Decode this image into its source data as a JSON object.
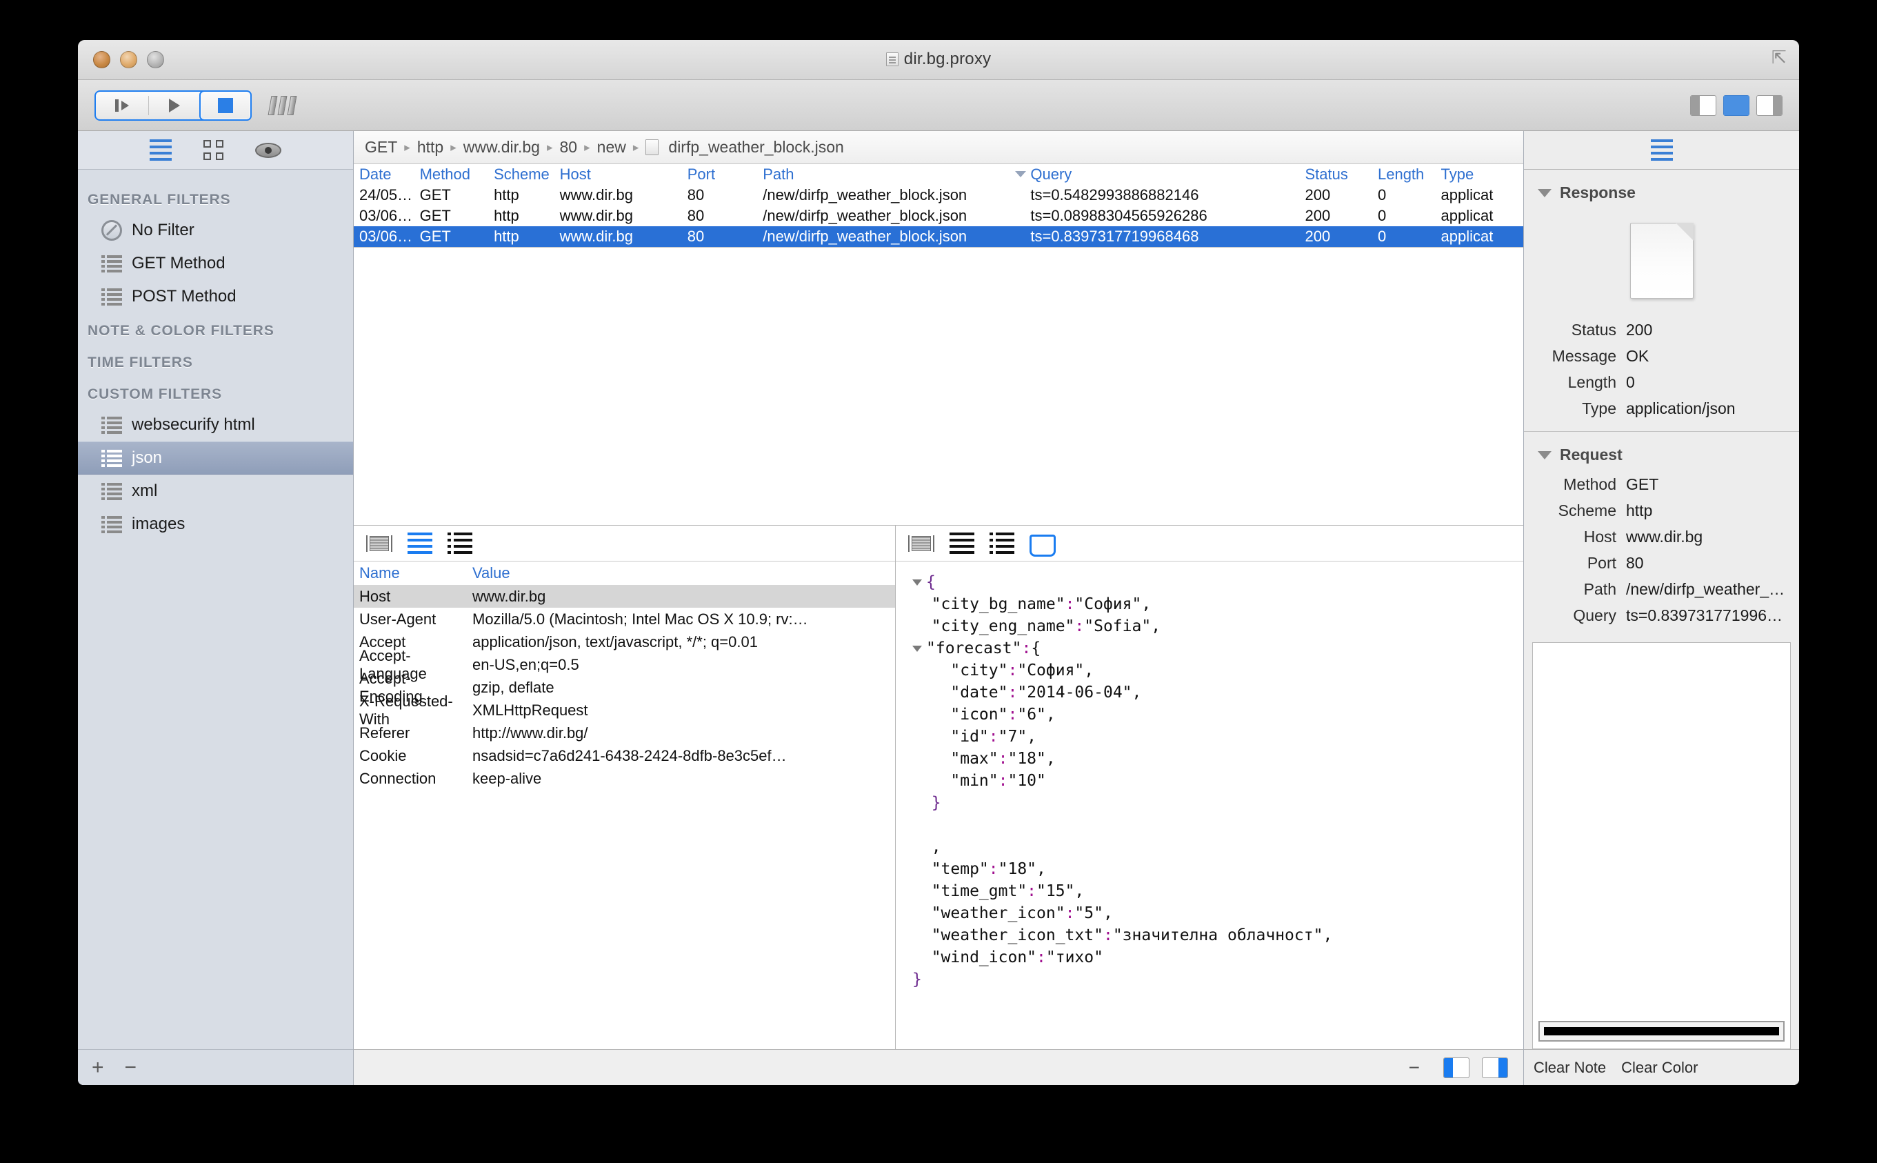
{
  "window": {
    "title": "dir.bg.proxy",
    "traffic_lights": [
      "close",
      "minimize",
      "zoom"
    ]
  },
  "toolbar": {
    "buttons": [
      {
        "name": "step",
        "icon": "step-forward-icon"
      },
      {
        "name": "play",
        "icon": "play-icon"
      },
      {
        "name": "stop",
        "icon": "stop-icon",
        "active": true
      }
    ],
    "columns_icon": "columns-icon",
    "pane_toggles": [
      {
        "name": "left-pane-toggle",
        "icon": "left-pane-icon"
      },
      {
        "name": "bottom-pane-toggle",
        "icon": "bottom-pane-icon"
      },
      {
        "name": "right-pane-toggle",
        "icon": "right-pane-icon"
      }
    ]
  },
  "sidebar": {
    "view_icons": [
      {
        "name": "list-view-icon",
        "active": true
      },
      {
        "name": "grid-view-icon",
        "active": false
      },
      {
        "name": "eye-icon",
        "active": false
      }
    ],
    "groups": [
      {
        "title": "GENERAL FILTERS",
        "items": [
          {
            "label": "No Filter",
            "icon": "no-filter-icon",
            "selected": false
          },
          {
            "label": "GET Method",
            "icon": "list-icon",
            "selected": false
          },
          {
            "label": "POST Method",
            "icon": "list-icon",
            "selected": false
          }
        ]
      },
      {
        "title": "NOTE & COLOR FILTERS",
        "items": []
      },
      {
        "title": "TIME FILTERS",
        "items": []
      },
      {
        "title": "CUSTOM FILTERS",
        "items": [
          {
            "label": "websecurify html",
            "icon": "list-icon",
            "selected": false
          },
          {
            "label": "json",
            "icon": "list-icon",
            "selected": true
          },
          {
            "label": "xml",
            "icon": "list-icon",
            "selected": false
          },
          {
            "label": "images",
            "icon": "list-icon",
            "selected": false
          }
        ]
      }
    ],
    "footer": {
      "add": "+",
      "remove": "−"
    }
  },
  "breadcrumb": {
    "separator": "▸",
    "parts": [
      "GET",
      "http",
      "www.dir.bg",
      "80",
      "new"
    ],
    "file": "dirfp_weather_block.json"
  },
  "requests_table": {
    "columns": [
      "Date",
      "Method",
      "Scheme",
      "Host",
      "Port",
      "Path",
      "Query",
      "Status",
      "Length",
      "Type"
    ],
    "sorted_column": "Query",
    "rows": [
      {
        "date": "24/05…",
        "method": "GET",
        "scheme": "http",
        "host": "www.dir.bg",
        "port": "80",
        "path": "/new/dirfp_weather_block.json",
        "query": "ts=0.5482993886882146",
        "status": "200",
        "length": "0",
        "type": "applicat",
        "selected": false
      },
      {
        "date": "03/06…",
        "method": "GET",
        "scheme": "http",
        "host": "www.dir.bg",
        "port": "80",
        "path": "/new/dirfp_weather_block.json",
        "query": "ts=0.08988304565926286",
        "status": "200",
        "length": "0",
        "type": "applicat",
        "selected": false
      },
      {
        "date": "03/06…",
        "method": "GET",
        "scheme": "http",
        "host": "www.dir.bg",
        "port": "80",
        "path": "/new/dirfp_weather_block.json",
        "query": "ts=0.8397317719968468",
        "status": "200",
        "length": "0",
        "type": "applicat",
        "selected": true
      }
    ]
  },
  "headers_panel": {
    "toolbar_icons": [
      {
        "name": "raw-view-icon",
        "active": false
      },
      {
        "name": "lines-view-icon",
        "active": true
      },
      {
        "name": "bullet-list-view-icon",
        "active": false
      }
    ],
    "columns": [
      "Name",
      "Value"
    ],
    "rows": [
      {
        "name": "Host",
        "value": "www.dir.bg",
        "selected": true
      },
      {
        "name": "User-Agent",
        "value": "Mozilla/5.0 (Macintosh; Intel Mac OS X 10.9; rv:…",
        "selected": false
      },
      {
        "name": "Accept",
        "value": "application/json, text/javascript, */*; q=0.01",
        "selected": false
      },
      {
        "name": "Accept-Language",
        "value": "en-US,en;q=0.5",
        "selected": false
      },
      {
        "name": "Accept-Encoding",
        "value": "gzip, deflate",
        "selected": false
      },
      {
        "name": "X-Requested-With",
        "value": "XMLHttpRequest",
        "selected": false
      },
      {
        "name": "Referer",
        "value": "http://www.dir.bg/",
        "selected": false
      },
      {
        "name": "Cookie",
        "value": "nsadsid=c7a6d241-6438-2424-8dfb-8e3c5ef…",
        "selected": false
      },
      {
        "name": "Connection",
        "value": "keep-alive",
        "selected": false
      }
    ]
  },
  "body_panel": {
    "toolbar_icons": [
      {
        "name": "raw-view-icon",
        "active": false
      },
      {
        "name": "lines-view-icon",
        "active": false
      },
      {
        "name": "bullet-list-view-icon",
        "active": false
      },
      {
        "name": "book-view-icon",
        "active": true
      }
    ],
    "json_lines": [
      {
        "indent": 0,
        "twisty": true,
        "text": "{"
      },
      {
        "indent": 1,
        "twisty": false,
        "text": "\"city_bg_name\":\"София\","
      },
      {
        "indent": 1,
        "twisty": false,
        "text": "\"city_eng_name\":\"Sofia\","
      },
      {
        "indent": 0,
        "twisty": true,
        "text": "\"forecast\":{"
      },
      {
        "indent": 2,
        "twisty": false,
        "text": "\"city\":\"София\","
      },
      {
        "indent": 2,
        "twisty": false,
        "text": "\"date\":\"2014-06-04\","
      },
      {
        "indent": 2,
        "twisty": false,
        "text": "\"icon\":\"6\","
      },
      {
        "indent": 2,
        "twisty": false,
        "text": "\"id\":\"7\","
      },
      {
        "indent": 2,
        "twisty": false,
        "text": "\"max\":\"18\","
      },
      {
        "indent": 2,
        "twisty": false,
        "text": "\"min\":\"10\""
      },
      {
        "indent": 1,
        "twisty": false,
        "text": "}"
      },
      {
        "indent": 1,
        "twisty": false,
        "text": ""
      },
      {
        "indent": 1,
        "twisty": false,
        "text": ","
      },
      {
        "indent": 1,
        "twisty": false,
        "text": "\"temp\":\"18\","
      },
      {
        "indent": 1,
        "twisty": false,
        "text": "\"time_gmt\":\"15\","
      },
      {
        "indent": 1,
        "twisty": false,
        "text": "\"weather_icon\":\"5\","
      },
      {
        "indent": 1,
        "twisty": false,
        "text": "\"weather_icon_txt\":\"значителна облачност\","
      },
      {
        "indent": 1,
        "twisty": false,
        "text": "\"wind_icon\":\"тихо\""
      },
      {
        "indent": 0,
        "twisty": false,
        "text": "}"
      }
    ]
  },
  "center_status": {
    "minus": "−",
    "toggles": [
      {
        "name": "left-split-toggle"
      },
      {
        "name": "right-split-toggle"
      }
    ]
  },
  "inspector": {
    "toolbar_icon": {
      "name": "list-view-icon",
      "active": true
    },
    "response": {
      "title": "Response",
      "preview_icon": "document-preview-icon",
      "rows": [
        {
          "label": "Status",
          "value": "200"
        },
        {
          "label": "Message",
          "value": "OK"
        },
        {
          "label": "Length",
          "value": "0"
        },
        {
          "label": "Type",
          "value": "application/json"
        }
      ]
    },
    "request": {
      "title": "Request",
      "rows": [
        {
          "label": "Method",
          "value": "GET"
        },
        {
          "label": "Scheme",
          "value": "http"
        },
        {
          "label": "Host",
          "value": "www.dir.bg"
        },
        {
          "label": "Port",
          "value": "80"
        },
        {
          "label": "Path",
          "value": "/new/dirfp_weather_…"
        },
        {
          "label": "Query",
          "value": "ts=0.839731771996…"
        }
      ]
    },
    "note": {
      "color_swatch": "#000000"
    },
    "footer": {
      "clear_note": "Clear Note",
      "clear_color": "Clear Color"
    }
  },
  "colors": {
    "accent_blue": "#2970d6",
    "header_blue": "#2e6fd0",
    "selection_blue": "#2970d6",
    "sidebar_bg": "#d8dde5",
    "window_bg": "#ececec",
    "json_punct": "#a0108f"
  }
}
